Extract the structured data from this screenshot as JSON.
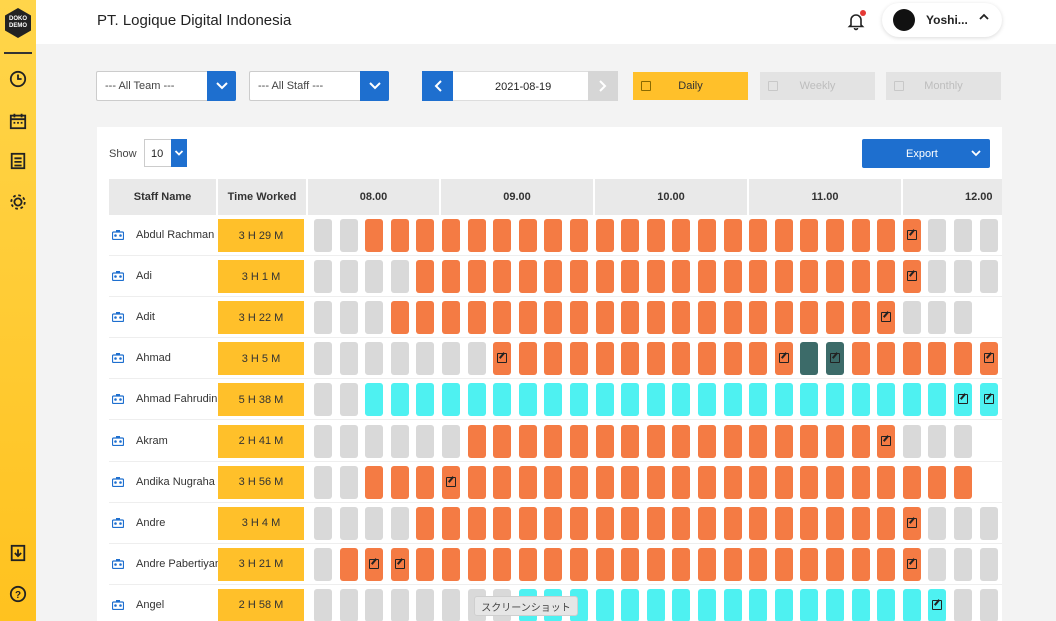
{
  "app": {
    "logo_text": "DOKO DEMO",
    "company_name": "PT. Logique Digital Indonesia",
    "user_name": "Yoshi..."
  },
  "sidebar": {
    "items": [
      {
        "icon": "clock-icon"
      },
      {
        "icon": "calendar-icon"
      },
      {
        "icon": "list-icon"
      },
      {
        "icon": "gear-icon"
      }
    ],
    "bottom_items": [
      {
        "icon": "download-icon"
      },
      {
        "icon": "help-icon"
      }
    ]
  },
  "filters": {
    "team": "--- All Team ---",
    "staff": "--- All Staff ---",
    "date": "2021-08-19",
    "views": {
      "daily": "Daily",
      "weekly": "Weekly",
      "monthly": "Monthly",
      "selected": "Daily"
    }
  },
  "table_controls": {
    "show_label": "Show",
    "page_size": "10",
    "export_label": "Export"
  },
  "table": {
    "headers": {
      "staff_name": "Staff Name",
      "time_worked": "Time Worked"
    },
    "hours": [
      "08.00",
      "09.00",
      "10.00",
      "11.00",
      "12.00"
    ],
    "rows": [
      {
        "name": "Abdul Rachman",
        "time_worked": "3 H 29 M",
        "blocks": "ggoooooooooooooooooooooNggg"
      },
      {
        "name": "Adi",
        "time_worked": "3 H 1 M",
        "blocks": "ggggoooooooooooooooooooNggg"
      },
      {
        "name": "Adit",
        "time_worked": "3 H 22 M",
        "blocks": "gggoooooooooooooooooooNggg"
      },
      {
        "name": "Ahmad",
        "time_worked": "3 H 5 M",
        "blocks": "gggggggNooooooooooNtToooooN"
      },
      {
        "name": "Ahmad Fahrudin",
        "time_worked": "5 H 38 M",
        "blocks": "ggcccccccccccccccccccccccDDc"
      },
      {
        "name": "Akram",
        "time_worked": "2 H 41 M",
        "blocks": "ggggggooooooooooooooooNggg"
      },
      {
        "name": "Andika Nugraha",
        "time_worked": "3 H 56 M",
        "blocks": "ggoooNoooooooooooooooooooo"
      },
      {
        "name": "Andre",
        "time_worked": "3 H 4 M",
        "blocks": "ggggooooooooooooooooooONggg"
      },
      {
        "name": "Andre Pabertiyan",
        "time_worked": "3 H 21 M",
        "blocks": "goNNoooooooooooooooooooNggg"
      },
      {
        "name": "Angel",
        "time_worked": "2 H 58 M",
        "blocks": "ggggggggccccccccccccccccDggg"
      }
    ]
  },
  "overlay": {
    "toast": "スクリーンショット"
  },
  "colors": {
    "sidebar": "#ffc21f",
    "accent_blue": "#1e6fcf",
    "time_worked_bg": "#ffc02a",
    "block_idle": "#d9d9d9",
    "block_work": "#f47b44",
    "block_remote": "#4ef1f1",
    "block_break": "#3c6b69"
  }
}
